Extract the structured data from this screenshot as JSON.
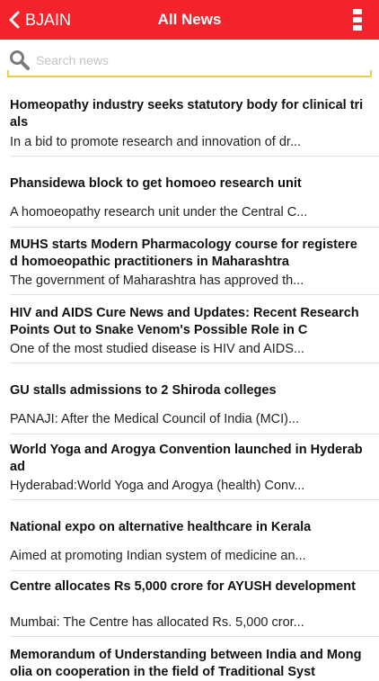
{
  "nav": {
    "back_label": "BJAIN",
    "title": "All News",
    "bar_color": "#f2232a"
  },
  "search": {
    "placeholder": "Search news",
    "value": ""
  },
  "news": [
    {
      "title": "Homeopathy industry seeks statutory body for clinical trials",
      "summary": "In a bid to promote research and innovation of dr..."
    },
    {
      "title": "Phansidewa block to get homoeo research unit",
      "summary": "A homoeopathy research unit under the Central C..."
    },
    {
      "title": "MUHS starts Modern Pharmacology course for registered homoeopathic practitioners in Maharashtra",
      "summary": "The government of Maharashtra has approved th..."
    },
    {
      "title": "HIV and AIDS Cure News and Updates: Recent Research Points Out to Snake Venom's Possible Role in C",
      "summary": "One of the most studied disease is HIV and AIDS..."
    },
    {
      "title": "GU stalls admissions to 2 Shiroda colleges",
      "summary": "PANAJI: After the Medical Council of India (MCI)..."
    },
    {
      "title": "World Yoga and Arogya Convention launched in Hyderabad",
      "summary": "Hyderabad:World Yoga and Arogya (health) Conv..."
    },
    {
      "title": "National expo on alternative healthcare in Kerala",
      "summary": "Aimed at promoting Indian system of medicine an..."
    },
    {
      "title": "Centre allocates Rs 5,000 crore for AYUSH development",
      "summary": "Mumbai: The Centre has allocated Rs. 5,000 cror..."
    },
    {
      "title": "Memorandum of Understanding between India and Mongolia on cooperation in the field of Traditional Syst",
      "summary": ""
    }
  ]
}
